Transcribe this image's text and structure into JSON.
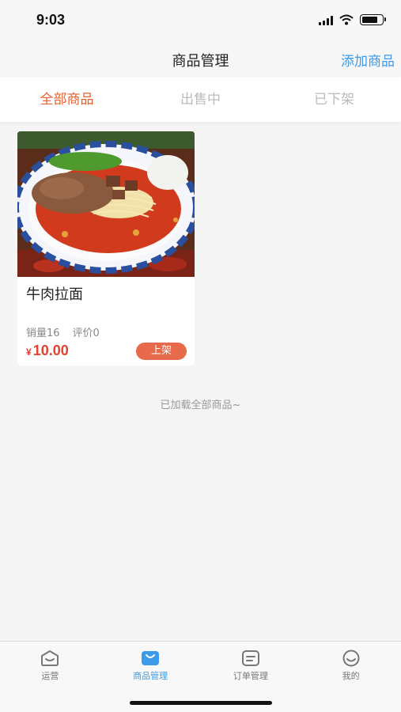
{
  "status_bar": {
    "time": "9:03"
  },
  "nav": {
    "title": "商品管理",
    "action": "添加商品"
  },
  "tabs": [
    {
      "label": "全部商品",
      "active": true
    },
    {
      "label": "出售中",
      "active": false
    },
    {
      "label": "已下架",
      "active": false
    }
  ],
  "products": [
    {
      "name": "牛肉拉面",
      "sales": "销量16",
      "reviews": "评价0",
      "currency": "¥",
      "price": "10.00",
      "action": "上架",
      "image": "beef-noodle-photo"
    }
  ],
  "load_tip": "已加载全部商品~",
  "tabbar": [
    {
      "label": "运营",
      "icon": "operations-icon",
      "active": false
    },
    {
      "label": "商品管理",
      "icon": "bag-icon",
      "active": true
    },
    {
      "label": "订单管理",
      "icon": "order-icon",
      "active": false
    },
    {
      "label": "我的",
      "icon": "smile-icon",
      "active": false
    }
  ],
  "colors": {
    "accent": "#e8602f",
    "price": "#e8402f",
    "link": "#3c9be8",
    "button": "#e86a4c"
  }
}
